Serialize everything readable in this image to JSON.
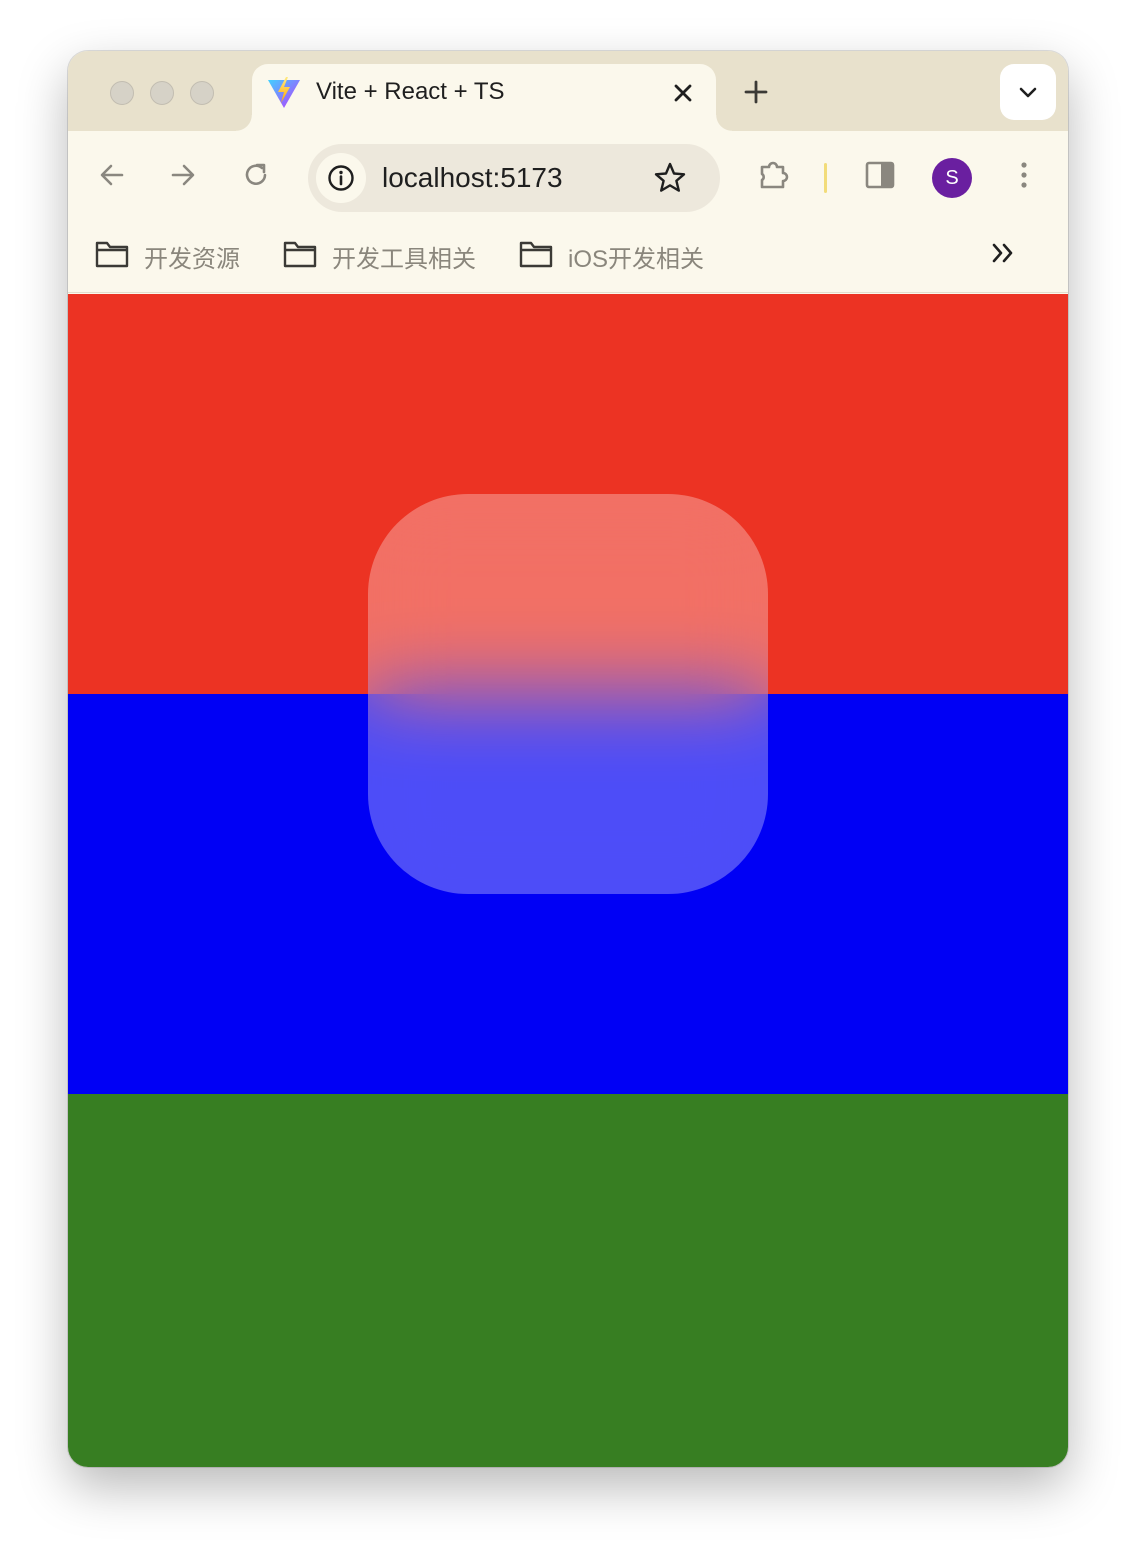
{
  "tab": {
    "title": "Vite + React + TS",
    "favicon": "vite-logo-icon"
  },
  "toolbar": {
    "url": "localhost:5173",
    "profile_initial": "S",
    "profile_color": "#6a1fa0"
  },
  "bookmarks": [
    {
      "label": "开发资源",
      "icon": "folder-icon"
    },
    {
      "label": "开发工具相关",
      "icon": "folder-icon"
    },
    {
      "label": "iOS开发相关",
      "icon": "folder-icon"
    }
  ],
  "page": {
    "bands": [
      {
        "name": "red",
        "color": "#ec3323"
      },
      {
        "name": "blue",
        "color": "#0000f5"
      },
      {
        "name": "green",
        "color": "#377e22"
      }
    ],
    "glass_tint": "rgba(255,255,255,0.3)"
  }
}
